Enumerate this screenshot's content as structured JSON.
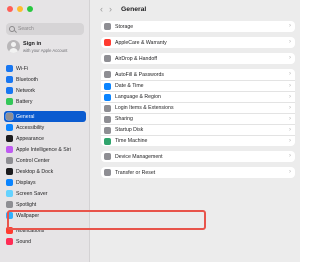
{
  "window": {
    "title": "General"
  },
  "colors": {
    "accent": "#0a5bd0",
    "highlight": "#e8544b"
  },
  "nav": {
    "back_icon": "chevron-left-icon",
    "forward_icon": "chevron-right-icon",
    "back": "‹",
    "forward": "›"
  },
  "search": {
    "placeholder": "Search"
  },
  "account": {
    "name": "Sign in",
    "subtitle": "with your Apple Account"
  },
  "sidebar": {
    "groups": [
      [
        {
          "label": "Wi-Fi",
          "icon": "wifi-icon",
          "color": "#1877f2"
        },
        {
          "label": "Bluetooth",
          "icon": "bluetooth-icon",
          "color": "#1877f2"
        },
        {
          "label": "Network",
          "icon": "network-icon",
          "color": "#1877f2"
        },
        {
          "label": "Battery",
          "icon": "battery-icon",
          "color": "#34c759"
        }
      ],
      [
        {
          "label": "General",
          "icon": "gear-icon",
          "color": "#8e8e93",
          "active": true
        },
        {
          "label": "Accessibility",
          "icon": "accessibility-icon",
          "color": "#0a84ff"
        },
        {
          "label": "Appearance",
          "icon": "appearance-icon",
          "color": "#1c1c1e"
        },
        {
          "label": "Apple Intelligence & Siri",
          "icon": "siri-icon",
          "color": "#bf5af2"
        },
        {
          "label": "Control Center",
          "icon": "control-center-icon",
          "color": "#8e8e93"
        },
        {
          "label": "Desktop & Dock",
          "icon": "dock-icon",
          "color": "#1c1c1e"
        },
        {
          "label": "Displays",
          "icon": "displays-icon",
          "color": "#0a84ff"
        },
        {
          "label": "Screen Saver",
          "icon": "screen-saver-icon",
          "color": "#64d2ff"
        },
        {
          "label": "Spotlight",
          "icon": "spotlight-icon",
          "color": "#8e8e93"
        },
        {
          "label": "Wallpaper",
          "icon": "wallpaper-icon",
          "color": "#30b0ff"
        }
      ],
      [
        {
          "label": "Notifications",
          "icon": "notifications-icon",
          "color": "#ff3b30"
        },
        {
          "label": "Sound",
          "icon": "sound-icon",
          "color": "#ff2d55"
        }
      ]
    ]
  },
  "main": {
    "groups": [
      [
        {
          "label": "Storage",
          "icon": "storage-icon",
          "color": "#8e8e93"
        }
      ],
      [
        {
          "label": "AppleCare & Warranty",
          "icon": "applecare-icon",
          "color": "#ff3b30"
        }
      ],
      [
        {
          "label": "AirDrop & Handoff",
          "icon": "airdrop-icon",
          "color": "#8e8e93"
        }
      ],
      [
        {
          "label": "AutoFill & Passwords",
          "icon": "autofill-icon",
          "color": "#8e8e93"
        },
        {
          "label": "Date & Time",
          "icon": "clock-icon",
          "color": "#0a84ff"
        },
        {
          "label": "Language & Region",
          "icon": "globe-icon",
          "color": "#0a84ff"
        },
        {
          "label": "Login Items & Extensions",
          "icon": "login-items-icon",
          "color": "#8e8e93"
        },
        {
          "label": "Sharing",
          "icon": "sharing-icon",
          "color": "#8e8e93"
        },
        {
          "label": "Startup Disk",
          "icon": "startup-disk-icon",
          "color": "#8e8e93"
        },
        {
          "label": "Time Machine",
          "icon": "time-machine-icon",
          "color": "#30a46c"
        }
      ],
      [
        {
          "label": "Device Management",
          "icon": "device-management-icon",
          "color": "#8e8e93",
          "highlighted": true
        }
      ],
      [
        {
          "label": "Transfer or Reset",
          "icon": "transfer-icon",
          "color": "#8e8e93"
        }
      ]
    ]
  }
}
